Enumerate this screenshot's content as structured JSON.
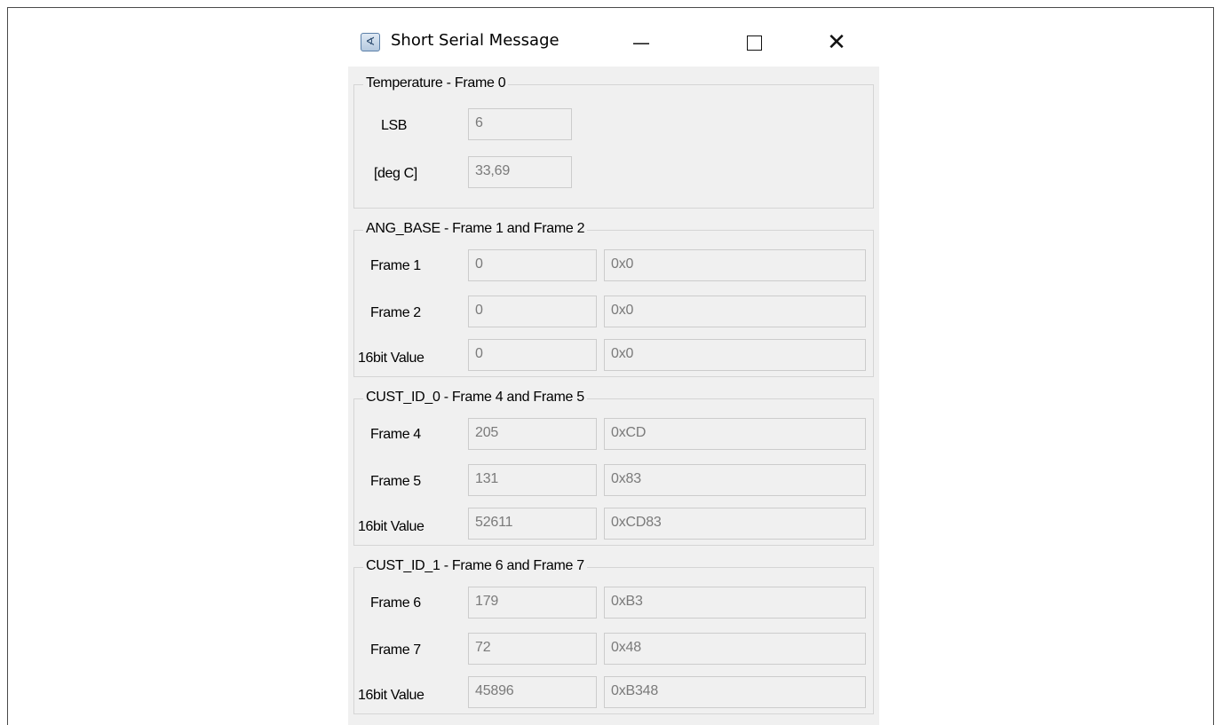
{
  "window": {
    "title": "Short Serial Message",
    "icon": "serial-app-icon",
    "controls": [
      "minimize-icon",
      "maximize-icon",
      "close-icon"
    ]
  },
  "groups": {
    "temperature": {
      "title": "Temperature - Frame 0",
      "rows": [
        {
          "label": "LSB",
          "value": "6"
        },
        {
          "label": "[deg C]",
          "value": "33,69"
        }
      ]
    },
    "ang_base": {
      "title": "ANG_BASE - Frame 1 and Frame 2",
      "rows": [
        {
          "label": "Frame 1",
          "dec": "0",
          "hex": "0x0"
        },
        {
          "label": "Frame 2",
          "dec": "0",
          "hex": "0x0"
        },
        {
          "label": "16bit Value",
          "dec": "0",
          "hex": "0x0"
        }
      ]
    },
    "cust_id_0": {
      "title": "CUST_ID_0 - Frame 4 and Frame 5",
      "rows": [
        {
          "label": "Frame 4",
          "dec": "205",
          "hex": "0xCD"
        },
        {
          "label": "Frame 5",
          "dec": "131",
          "hex": "0x83"
        },
        {
          "label": "16bit Value",
          "dec": "52611",
          "hex": "0xCD83"
        }
      ]
    },
    "cust_id_1": {
      "title": "CUST_ID_1 - Frame 6 and Frame 7",
      "rows": [
        {
          "label": "Frame 6",
          "dec": "179",
          "hex": "0xB3"
        },
        {
          "label": "Frame 7",
          "dec": "72",
          "hex": "0x48"
        },
        {
          "label": "16bit Value",
          "dec": "45896",
          "hex": "0xB348"
        }
      ]
    }
  }
}
